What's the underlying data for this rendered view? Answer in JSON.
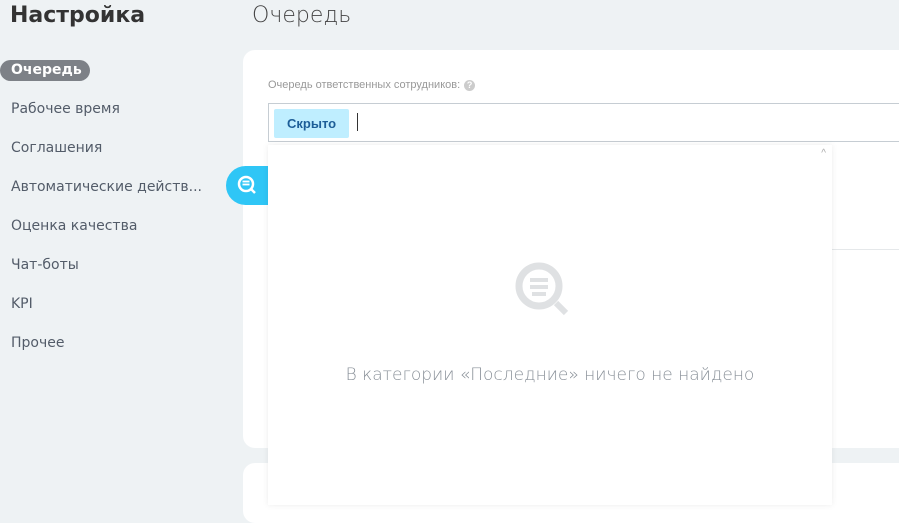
{
  "sidebar": {
    "title": "Настройка",
    "items": [
      {
        "label": "Очередь",
        "active": true
      },
      {
        "label": "Рабочее время"
      },
      {
        "label": "Соглашения"
      },
      {
        "label": "Автоматические действ..."
      },
      {
        "label": "Оценка качества"
      },
      {
        "label": "Чат-боты"
      },
      {
        "label": "KPI"
      },
      {
        "label": "Прочее"
      }
    ]
  },
  "main": {
    "title": "Очередь",
    "field_label": "Очередь ответственных сотрудников:",
    "tag": "Скрыто",
    "help": "?"
  },
  "dropdown": {
    "empty_text": "В категории «Последние» ничего не найдено",
    "scroll_up": "^"
  },
  "colors": {
    "accent": "#2fc6f6",
    "tag_bg": "#bfeeff"
  }
}
